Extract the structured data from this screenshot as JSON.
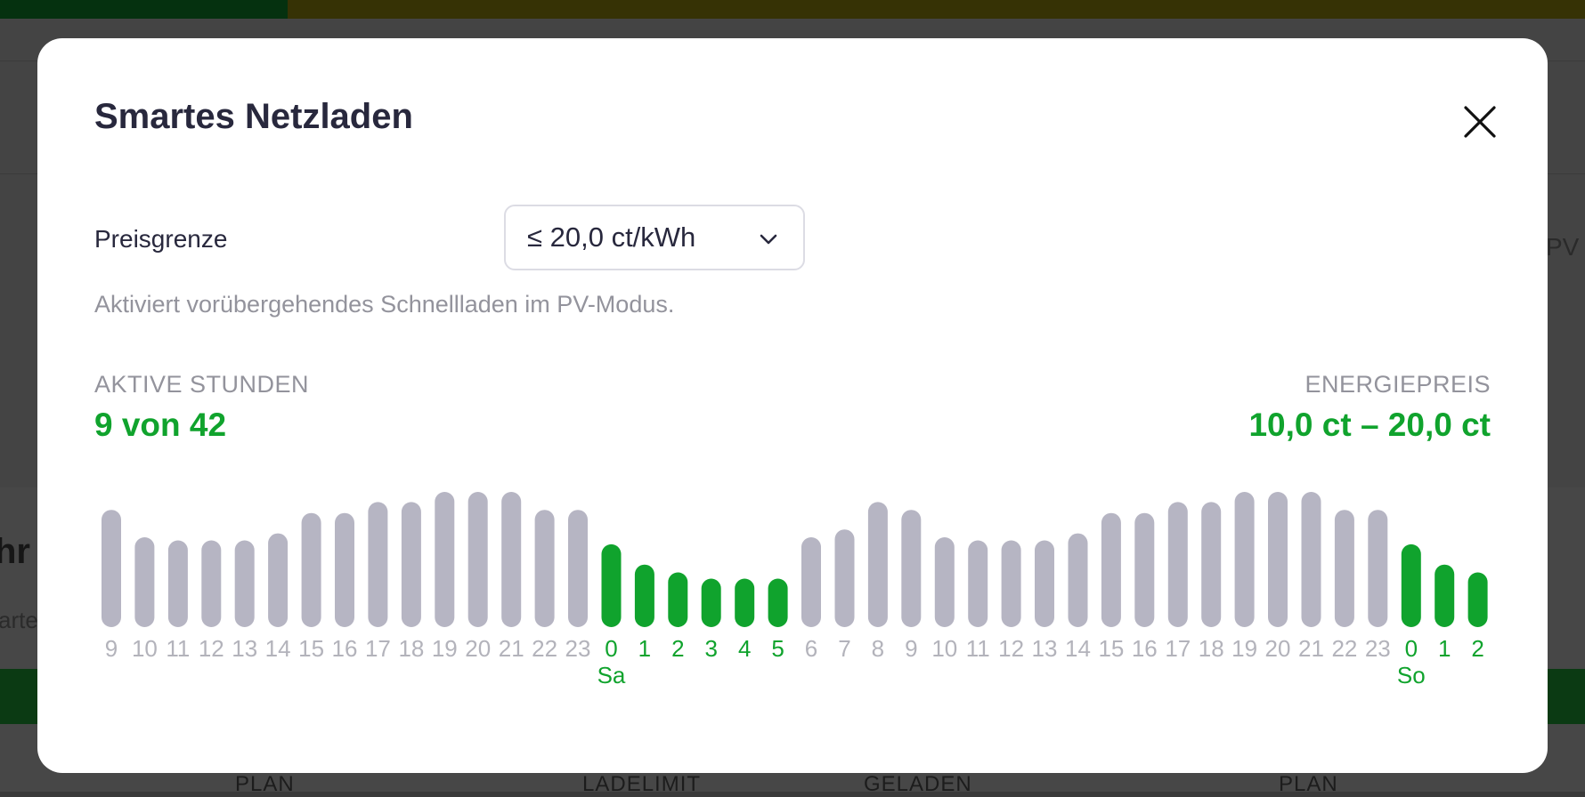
{
  "modal": {
    "title": "Smartes Netzladen",
    "price_limit": {
      "label": "Preisgrenze",
      "selected": "≤ 20,0 ct/kWh"
    },
    "hint": "Aktiviert vorübergehendes Schnellladen im PV-Modus.",
    "active_hours": {
      "label": "AKTIVE STUNDEN",
      "value": "9 von 42"
    },
    "energy_price": {
      "label": "ENERGIEPREIS",
      "value": "10,0 ct – 20,0 ct"
    }
  },
  "background": {
    "partial_heading": "hr",
    "partial_text": "arte",
    "partial_pv": "PV",
    "footer_labels": [
      "PLAN",
      "LADELIMIT",
      "GELADEN",
      "PLAN"
    ]
  },
  "colors": {
    "active": "#10a32d",
    "inactive_bar": "#b6b5c3",
    "inactive_label": "#b3b3bb",
    "title": "#28283d",
    "muted": "#93939c"
  },
  "chart_data": {
    "type": "bar",
    "hours": [
      "9",
      "10",
      "11",
      "12",
      "13",
      "14",
      "15",
      "16",
      "17",
      "18",
      "19",
      "20",
      "21",
      "22",
      "23",
      "0",
      "1",
      "2",
      "3",
      "4",
      "5",
      "6",
      "7",
      "8",
      "9",
      "10",
      "11",
      "12",
      "13",
      "14",
      "15",
      "16",
      "17",
      "18",
      "19",
      "20",
      "21",
      "22",
      "23",
      "0",
      "1",
      "2"
    ],
    "day_labels": [
      {
        "index": 15,
        "label": "Sa"
      },
      {
        "index": 39,
        "label": "So"
      }
    ],
    "values": [
      150,
      115,
      111,
      111,
      111,
      120,
      146,
      146,
      160,
      160,
      173,
      173,
      173,
      150,
      150,
      106,
      80,
      70,
      62,
      62,
      62,
      115,
      125,
      160,
      150,
      115,
      111,
      111,
      111,
      120,
      146,
      146,
      160,
      160,
      173,
      173,
      173,
      150,
      150,
      106,
      80,
      70
    ],
    "active": [
      false,
      false,
      false,
      false,
      false,
      false,
      false,
      false,
      false,
      false,
      false,
      false,
      false,
      false,
      false,
      true,
      true,
      true,
      true,
      true,
      true,
      false,
      false,
      false,
      false,
      false,
      false,
      false,
      false,
      false,
      false,
      false,
      false,
      false,
      false,
      false,
      false,
      false,
      false,
      true,
      true,
      true
    ]
  }
}
